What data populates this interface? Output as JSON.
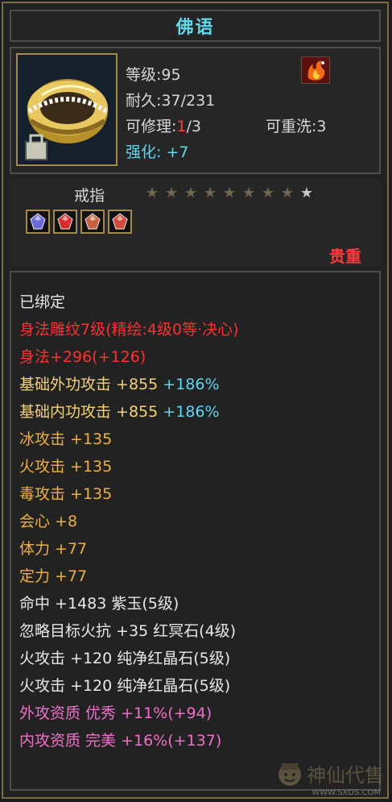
{
  "window": {
    "title": "佛语"
  },
  "item": {
    "level_label": "等级",
    "level_value": ":95",
    "durability_label": "耐久",
    "durability_value": ":37/231",
    "repair_label": "可修理",
    "repair_sep": ":",
    "repair_current": "1",
    "repair_max": "/3",
    "rewash_label": "可重洗",
    "rewash_value": ":3",
    "enhance_label": "强化:",
    "enhance_value": "+7",
    "type": "戒指",
    "stars_total": 9,
    "stars_lit": 1,
    "precious_label": "贵重"
  },
  "gems": [
    {
      "name": "purple-gem-icon",
      "color": "#6a6ad8"
    },
    {
      "name": "red-gem-icon",
      "color": "#d83030"
    },
    {
      "name": "red-green-gem-icon",
      "color": "#c86040"
    },
    {
      "name": "red-gold-gem-icon",
      "color": "#d04a3a"
    }
  ],
  "attributes": [
    {
      "text": "已绑定",
      "color": "white"
    },
    {
      "text": "身法雕纹7级(精绘:4级0等·决心)",
      "color": "red"
    },
    {
      "text": "身法+296(+126)",
      "color": "red"
    },
    {
      "text": "基础外功攻击 +855",
      "extra": " +186%",
      "color": "yellow"
    },
    {
      "text": "基础内功攻击 +855",
      "extra": " +186%",
      "color": "yellow"
    },
    {
      "text": "冰攻击 +135",
      "color": "orange"
    },
    {
      "text": "火攻击 +135",
      "color": "orange"
    },
    {
      "text": "毒攻击 +135",
      "color": "orange"
    },
    {
      "text": "会心 +8",
      "color": "orange"
    },
    {
      "text": "体力 +77",
      "color": "orange"
    },
    {
      "text": "定力 +77",
      "color": "orange"
    },
    {
      "text": "命中 +1483 紫玉(5级)",
      "color": "white"
    },
    {
      "text": "忽略目标火抗 +35 红冥石(4级)",
      "color": "white"
    },
    {
      "text": "火攻击 +120 纯净红晶石(5级)",
      "color": "white"
    },
    {
      "text": "火攻击 +120 纯净红晶石(5级)",
      "color": "white"
    },
    {
      "text": "外攻资质  优秀 +11%(+94)",
      "color": "pink"
    },
    {
      "text": "内攻资质  完美 +16%(+137)",
      "color": "pink"
    }
  ],
  "watermark": {
    "text": "神仙代售",
    "url": "WWW.SXDS.COM"
  }
}
